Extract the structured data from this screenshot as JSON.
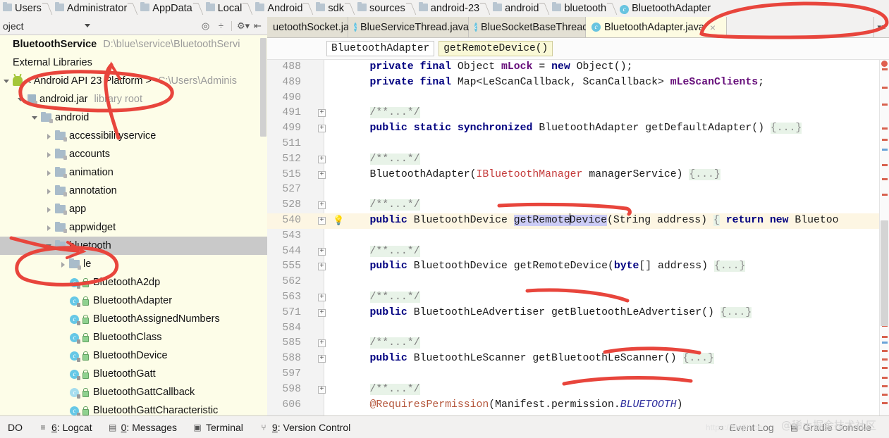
{
  "navbar": {
    "crumbs": [
      {
        "label": "Users",
        "icon": "folder-icon"
      },
      {
        "label": "Administrator",
        "icon": "folder-icon"
      },
      {
        "label": "AppData",
        "icon": "folder-icon"
      },
      {
        "label": "Local",
        "icon": "folder-icon"
      },
      {
        "label": "Android",
        "icon": "folder-icon"
      },
      {
        "label": "sdk",
        "icon": "folder-icon"
      },
      {
        "label": "sources",
        "icon": "folder-icon"
      },
      {
        "label": "android-23",
        "icon": "folder-icon"
      },
      {
        "label": "android",
        "icon": "folder-icon"
      },
      {
        "label": "bluetooth",
        "icon": "folder-icon"
      },
      {
        "label": "BluetoothAdapter",
        "icon": "class-icon"
      }
    ]
  },
  "project_panel": {
    "title": "oject",
    "toolbar_icons": [
      "target-icon",
      "collapse-all-icon",
      "gear-icon",
      "hide-panel-icon"
    ],
    "tree": [
      {
        "label": "BluetoothService",
        "secondary": "D:\\blue\\service\\BluetoothServi",
        "icon": "module-icon",
        "indent": 0,
        "arrow": "none",
        "bold": true
      },
      {
        "label": "External Libraries",
        "secondary": "",
        "icon": "none",
        "indent": 0,
        "arrow": "none",
        "bold": false
      },
      {
        "label": "< Android API 23 Platform >",
        "secondary": "C:\\Users\\Adminis",
        "icon": "android-icon",
        "indent": 0,
        "arrow": "open",
        "bold": false
      },
      {
        "label": "android.jar",
        "secondary": "library root",
        "icon": "jar-icon",
        "indent": 1,
        "arrow": "open",
        "bold": false
      },
      {
        "label": "android",
        "secondary": "",
        "icon": "package-icon",
        "indent": 2,
        "arrow": "open",
        "bold": false
      },
      {
        "label": "accessibilityservice",
        "secondary": "",
        "icon": "package-icon",
        "indent": 3,
        "arrow": "closed",
        "bold": false
      },
      {
        "label": "accounts",
        "secondary": "",
        "icon": "package-icon",
        "indent": 3,
        "arrow": "closed",
        "bold": false
      },
      {
        "label": "animation",
        "secondary": "",
        "icon": "package-icon",
        "indent": 3,
        "arrow": "closed",
        "bold": false
      },
      {
        "label": "annotation",
        "secondary": "",
        "icon": "package-icon",
        "indent": 3,
        "arrow": "closed",
        "bold": false
      },
      {
        "label": "app",
        "secondary": "",
        "icon": "package-icon",
        "indent": 3,
        "arrow": "closed",
        "bold": false
      },
      {
        "label": "appwidget",
        "secondary": "",
        "icon": "package-icon",
        "indent": 3,
        "arrow": "closed",
        "bold": false
      },
      {
        "label": "bluetooth",
        "secondary": "",
        "icon": "package-icon",
        "indent": 3,
        "arrow": "open",
        "bold": false,
        "selected": true
      },
      {
        "label": "le",
        "secondary": "",
        "icon": "package-icon",
        "indent": 4,
        "arrow": "closed",
        "bold": false
      },
      {
        "label": "BluetoothA2dp",
        "secondary": "",
        "icon": "class-icon",
        "indent": 4,
        "arrow": "none",
        "bold": false
      },
      {
        "label": "BluetoothAdapter",
        "secondary": "",
        "icon": "class-icon",
        "indent": 4,
        "arrow": "none",
        "bold": false
      },
      {
        "label": "BluetoothAssignedNumbers",
        "secondary": "",
        "icon": "class-icon",
        "indent": 4,
        "arrow": "none",
        "bold": false
      },
      {
        "label": "BluetoothClass",
        "secondary": "",
        "icon": "class-icon",
        "indent": 4,
        "arrow": "none",
        "bold": false
      },
      {
        "label": "BluetoothDevice",
        "secondary": "",
        "icon": "class-icon",
        "indent": 4,
        "arrow": "none",
        "bold": false
      },
      {
        "label": "BluetoothGatt",
        "secondary": "",
        "icon": "class-icon",
        "indent": 4,
        "arrow": "none",
        "bold": false
      },
      {
        "label": "BluetoothGattCallback",
        "secondary": "",
        "icon": "interface-icon",
        "indent": 4,
        "arrow": "none",
        "bold": false
      },
      {
        "label": "BluetoothGattCharacteristic",
        "secondary": "",
        "icon": "class-icon",
        "indent": 4,
        "arrow": "none",
        "bold": false
      }
    ]
  },
  "editor_tabs": [
    {
      "label": "uetoothSocket.java",
      "icon": "none",
      "active": false,
      "closable": true
    },
    {
      "label": "BlueServiceThread.java",
      "icon": "class-icon",
      "active": false,
      "closable": true
    },
    {
      "label": "BlueSocketBaseThread.java",
      "icon": "class-icon",
      "active": false,
      "closable": false
    },
    {
      "label": "BluetoothAdapter.java",
      "icon": "class-locked-icon",
      "active": true,
      "closable": true
    }
  ],
  "structure_bar": {
    "class_chip": "BluetoothAdapter",
    "member_chip": "getRemoteDevice()"
  },
  "code_lines": [
    {
      "num": "488",
      "fold": false,
      "bulb": false,
      "highlight": false,
      "tokens": [
        {
          "t": "    ",
          "c": ""
        },
        {
          "t": "private",
          "c": "kw"
        },
        {
          "t": " ",
          "c": ""
        },
        {
          "t": "final",
          "c": "kw"
        },
        {
          "t": " Object ",
          "c": ""
        },
        {
          "t": "mLock",
          "c": "fld"
        },
        {
          "t": " = ",
          "c": ""
        },
        {
          "t": "new",
          "c": "kw"
        },
        {
          "t": " Object();",
          "c": ""
        }
      ]
    },
    {
      "num": "489",
      "fold": false,
      "bulb": false,
      "highlight": false,
      "tokens": [
        {
          "t": "    ",
          "c": ""
        },
        {
          "t": "private",
          "c": "kw"
        },
        {
          "t": " ",
          "c": ""
        },
        {
          "t": "final",
          "c": "kw"
        },
        {
          "t": " Map<LeScanCallback, ScanCallback> ",
          "c": ""
        },
        {
          "t": "mLeScanClients",
          "c": "fld"
        },
        {
          "t": ";",
          "c": ""
        }
      ]
    },
    {
      "num": "490",
      "fold": false,
      "bulb": false,
      "highlight": false,
      "tokens": []
    },
    {
      "num": "491",
      "fold": true,
      "bulb": false,
      "highlight": false,
      "tokens": [
        {
          "t": "    ",
          "c": ""
        },
        {
          "t": "/**...*/",
          "c": "doc"
        }
      ]
    },
    {
      "num": "499",
      "fold": true,
      "bulb": false,
      "highlight": false,
      "tokens": [
        {
          "t": "    ",
          "c": ""
        },
        {
          "t": "public",
          "c": "kw"
        },
        {
          "t": " ",
          "c": ""
        },
        {
          "t": "static",
          "c": "kw"
        },
        {
          "t": " ",
          "c": ""
        },
        {
          "t": "synchronized",
          "c": "kw"
        },
        {
          "t": " BluetoothAdapter getDefaultAdapter() ",
          "c": ""
        },
        {
          "t": "{...}",
          "c": "braces"
        }
      ]
    },
    {
      "num": "511",
      "fold": false,
      "bulb": false,
      "highlight": false,
      "tokens": []
    },
    {
      "num": "512",
      "fold": true,
      "bulb": false,
      "highlight": false,
      "tokens": [
        {
          "t": "    ",
          "c": ""
        },
        {
          "t": "/**...*/",
          "c": "doc"
        }
      ]
    },
    {
      "num": "515",
      "fold": true,
      "bulb": false,
      "highlight": false,
      "tokens": [
        {
          "t": "    BluetoothAdapter(",
          "c": ""
        },
        {
          "t": "IBluetoothManager",
          "c": "ifc"
        },
        {
          "t": " managerService) ",
          "c": ""
        },
        {
          "t": "{...}",
          "c": "braces"
        }
      ]
    },
    {
      "num": "527",
      "fold": false,
      "bulb": false,
      "highlight": false,
      "tokens": []
    },
    {
      "num": "528",
      "fold": true,
      "bulb": false,
      "highlight": false,
      "tokens": [
        {
          "t": "    ",
          "c": ""
        },
        {
          "t": "/**...*/",
          "c": "doc"
        }
      ]
    },
    {
      "num": "540",
      "fold": true,
      "bulb": true,
      "highlight": true,
      "tokens": [
        {
          "t": "    ",
          "c": ""
        },
        {
          "t": "public",
          "c": "kw"
        },
        {
          "t": " BluetoothDevice ",
          "c": ""
        },
        {
          "t": "getRemote|Device",
          "c": "sel-caret"
        },
        {
          "t": "(String address) ",
          "c": ""
        },
        {
          "t": "{",
          "c": "braces"
        },
        {
          "t": " ",
          "c": ""
        },
        {
          "t": "return",
          "c": "kw"
        },
        {
          "t": " ",
          "c": ""
        },
        {
          "t": "new",
          "c": "kw"
        },
        {
          "t": " Bluetoo",
          "c": ""
        }
      ]
    },
    {
      "num": "543",
      "fold": false,
      "bulb": false,
      "highlight": false,
      "tokens": []
    },
    {
      "num": "544",
      "fold": true,
      "bulb": false,
      "highlight": false,
      "tokens": [
        {
          "t": "    ",
          "c": ""
        },
        {
          "t": "/**...*/",
          "c": "doc"
        }
      ]
    },
    {
      "num": "555",
      "fold": true,
      "bulb": false,
      "highlight": false,
      "tokens": [
        {
          "t": "    ",
          "c": ""
        },
        {
          "t": "public",
          "c": "kw"
        },
        {
          "t": " BluetoothDevice getRemoteDevice(",
          "c": ""
        },
        {
          "t": "byte",
          "c": "kw"
        },
        {
          "t": "[] address) ",
          "c": ""
        },
        {
          "t": "{...}",
          "c": "braces"
        }
      ]
    },
    {
      "num": "562",
      "fold": false,
      "bulb": false,
      "highlight": false,
      "tokens": []
    },
    {
      "num": "563",
      "fold": true,
      "bulb": false,
      "highlight": false,
      "tokens": [
        {
          "t": "    ",
          "c": ""
        },
        {
          "t": "/**...*/",
          "c": "doc"
        }
      ]
    },
    {
      "num": "571",
      "fold": true,
      "bulb": false,
      "highlight": false,
      "tokens": [
        {
          "t": "    ",
          "c": ""
        },
        {
          "t": "public",
          "c": "kw"
        },
        {
          "t": " BluetoothLeAdvertiser getBluetoothLeAdvertiser() ",
          "c": ""
        },
        {
          "t": "{...}",
          "c": "braces"
        }
      ]
    },
    {
      "num": "584",
      "fold": false,
      "bulb": false,
      "highlight": false,
      "tokens": []
    },
    {
      "num": "585",
      "fold": true,
      "bulb": false,
      "highlight": false,
      "tokens": [
        {
          "t": "    ",
          "c": ""
        },
        {
          "t": "/**...*/",
          "c": "doc"
        }
      ]
    },
    {
      "num": "588",
      "fold": true,
      "bulb": false,
      "highlight": false,
      "tokens": [
        {
          "t": "    ",
          "c": ""
        },
        {
          "t": "public",
          "c": "kw"
        },
        {
          "t": " BluetoothLeScanner getBluetoothLeScanner() ",
          "c": ""
        },
        {
          "t": "{...}",
          "c": "braces"
        }
      ]
    },
    {
      "num": "597",
      "fold": false,
      "bulb": false,
      "highlight": false,
      "tokens": []
    },
    {
      "num": "598",
      "fold": true,
      "bulb": false,
      "highlight": false,
      "tokens": [
        {
          "t": "    ",
          "c": ""
        },
        {
          "t": "/**...*/",
          "c": "doc"
        }
      ]
    },
    {
      "num": "606",
      "fold": false,
      "bulb": false,
      "highlight": false,
      "tokens": [
        {
          "t": "    ",
          "c": ""
        },
        {
          "t": "@RequiresPermission",
          "c": "anno-red"
        },
        {
          "t": "(Manifest.permission.",
          "c": ""
        },
        {
          "t": "BLUETOOTH",
          "c": "str-it"
        },
        {
          "t": ")",
          "c": ""
        }
      ]
    }
  ],
  "statusbar": {
    "left_label": "DO",
    "items": [
      {
        "num": "6",
        "label": "Logcat",
        "icon": "logcat-icon"
      },
      {
        "num": "0",
        "label": "Messages",
        "icon": "messages-icon"
      },
      {
        "num": "",
        "label": "Terminal",
        "icon": "terminal-icon"
      },
      {
        "num": "9",
        "label": "Version Control",
        "icon": "vcs-icon"
      }
    ],
    "right_items": [
      {
        "label": "Event Log",
        "icon": "event-log-icon"
      },
      {
        "label": "Gradle Console",
        "icon": "gradle-icon"
      }
    ],
    "watermark": "@稀土掘金技术社区",
    "watermark_url": "https://juejin.cn"
  },
  "colors": {
    "annotation_red": "#e8453c",
    "tab_active_bg": "#fdfbe2",
    "tree_bg": "#fdfde8",
    "selection_blue": "#ccccf6",
    "keyword_navy": "#000080",
    "field_purple": "#660e7a"
  }
}
